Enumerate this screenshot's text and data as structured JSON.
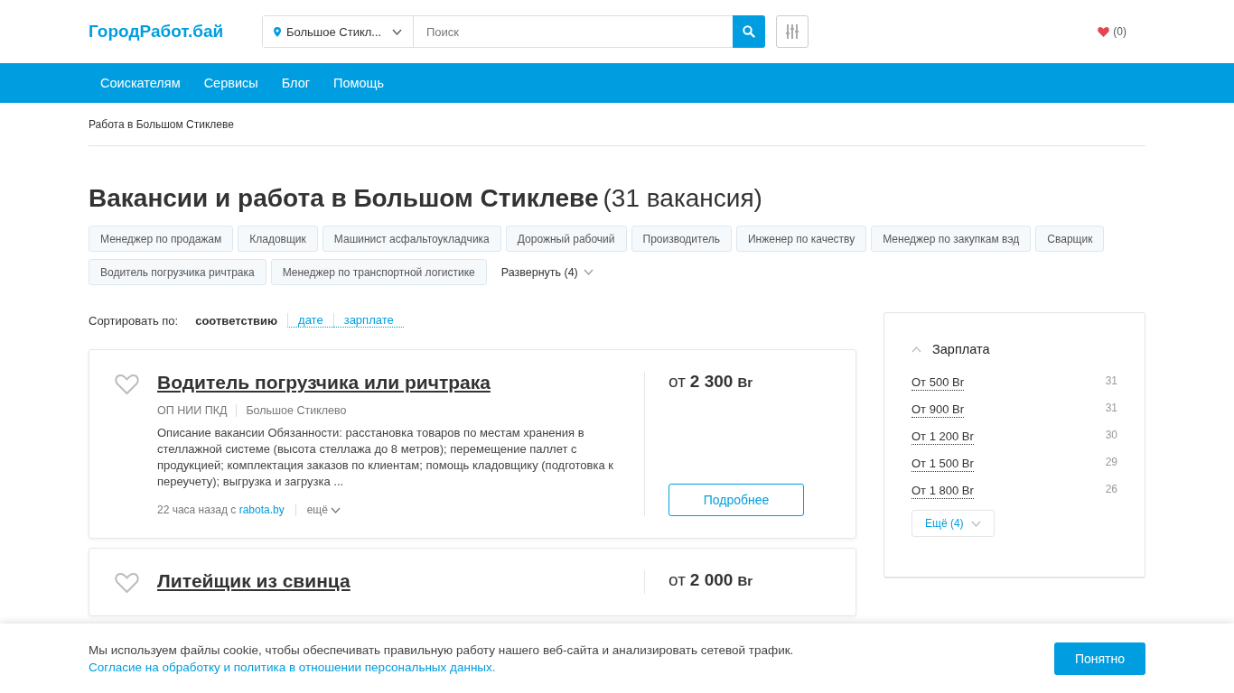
{
  "header": {
    "logo": "ГородРабот.бай",
    "location": "Большое Стикл...",
    "search": {
      "placeholder": "Поиск"
    },
    "favorites": "(0)"
  },
  "nav": [
    "Соискателям",
    "Сервисы",
    "Блог",
    "Помощь"
  ],
  "breadcrumb": "Работа в Большом Стиклеве",
  "heading": {
    "title": "Вакансии и работа в Большом Стиклеве",
    "count": "(31 вакансия)"
  },
  "tags": [
    "Менеджер по продажам",
    "Кладовщик",
    "Машинист асфальтоукладчика",
    "Дорожный рабочий",
    "Производитель",
    "Инженер по качеству",
    "Менеджер по закупкам вэд",
    "Сварщик",
    "Водитель погрузчика ричтрака",
    "Менеджер по транспортной логистике"
  ],
  "expand_tags": "Развернуть (4)",
  "sort": {
    "label": "Сортировать по:",
    "options": [
      {
        "label": "соответствию",
        "selected": true
      },
      {
        "label": "дате",
        "selected": false
      },
      {
        "label": "зарплате",
        "selected": false
      }
    ]
  },
  "vacancies": [
    {
      "title": "Водитель погрузчика или ричтрака",
      "company": "ОП НИИ ПКД",
      "city": "Большое Стиклево",
      "description": "Описание вакансии Обязанности: расстановка товаров по местам хранения в стеллажной системе (высота стеллажа до 8 метров); перемещение паллет с продукцией; комплектация заказов по клиентам; помощь кладовщику (подготовка к переучету); выгрузка и загрузка ...",
      "posted": "22 часа назад с",
      "source": "rabota.by",
      "more": "ещё",
      "salary_prefix": "от",
      "salary_amount": "2 300",
      "currency": "Br",
      "details_button": "Подробнее"
    },
    {
      "title": "Литейщик из свинца",
      "salary_prefix": "от",
      "salary_amount": "2 000",
      "currency": "Br"
    }
  ],
  "salary_filter": {
    "title": "Зарплата",
    "expanded": true,
    "options": [
      {
        "label": "От 500 Br",
        "count": "31"
      },
      {
        "label": "От 900 Br",
        "count": "31"
      },
      {
        "label": "От 1 200 Br",
        "count": "30"
      },
      {
        "label": "От 1 500 Br",
        "count": "29"
      },
      {
        "label": "От 1 800 Br",
        "count": "26"
      }
    ],
    "more": "Ещё (4)"
  },
  "cookie_banner": {
    "text": "Мы используем файлы cookie, чтобы обеспечивать правильную работу нашего веб-сайта и анализировать сетевой трафик.",
    "link": "Согласие на обработку и политика в отношении персональных данных.",
    "button": "Понятно"
  }
}
